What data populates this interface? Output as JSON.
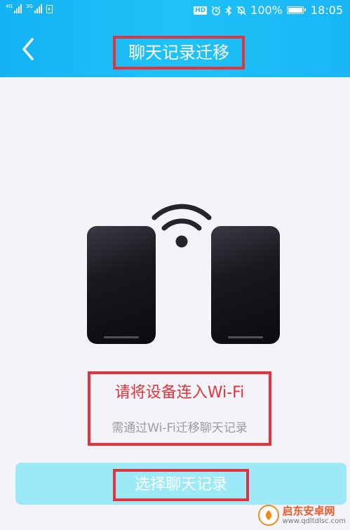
{
  "status_bar": {
    "network_1": "4G",
    "network_2": "3G",
    "hd_badge": "HD",
    "battery_percent": "100%",
    "battery_level": 1.0,
    "time": "18:05"
  },
  "header": {
    "title": "聊天记录迁移",
    "background_color": "#1ab8f6"
  },
  "main": {
    "message": "请将设备连入Wi-Fi",
    "sub_message": "需通过Wi-Fi迁移聊天记录",
    "message_color": "#e5323c"
  },
  "action": {
    "select_records_label": "选择聊天记录",
    "button_color": "#9ceaf8"
  },
  "watermark": {
    "name": "启东安卓网",
    "url": "www.qdltdlsc.com"
  },
  "icons": [
    "back-arrow-icon",
    "wifi-icon",
    "phone-icon",
    "signal-icon",
    "alarm-icon",
    "bluetooth-icon",
    "mute-icon",
    "battery-icon"
  ]
}
